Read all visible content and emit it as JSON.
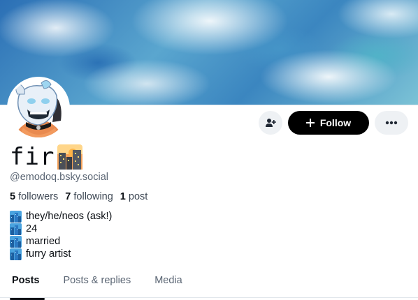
{
  "profile": {
    "display_name": "fir",
    "handle": "@emodoq.bsky.social",
    "stats": {
      "followers_count": "5",
      "followers_label": "followers",
      "following_count": "7",
      "following_label": "following",
      "posts_count": "1",
      "posts_label": "post"
    },
    "bio": [
      "they/he/neos (ask!)",
      "24",
      "married",
      "furry artist"
    ]
  },
  "actions": {
    "follow_label": "Follow",
    "icons": [
      "add-user-icon",
      "plus-icon",
      "more-horizontal-icon"
    ]
  },
  "tabs": [
    {
      "label": "Posts",
      "active": true
    },
    {
      "label": "Posts & replies",
      "active": false
    },
    {
      "label": "Media",
      "active": false
    }
  ],
  "colors": {
    "follow_bg": "#000000",
    "secondary_btn_bg": "#eef1f4",
    "muted_text": "#5a6573"
  }
}
